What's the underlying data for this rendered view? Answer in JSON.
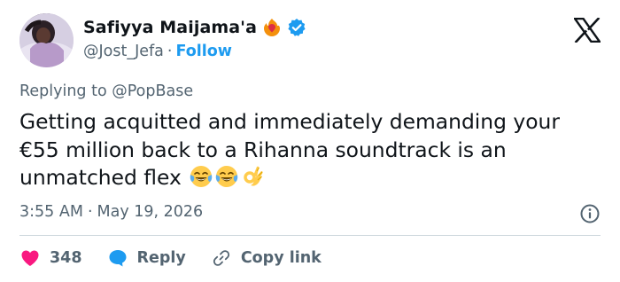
{
  "user": {
    "display_name": "Safiyya Maijama'a",
    "handle": "@Jost_Jefa",
    "separator": "·",
    "follow_label": "Follow"
  },
  "reply_context": {
    "prefix": "Replying to",
    "mention": "@PopBase"
  },
  "tweet": {
    "text": "Getting acquitted and immediately demanding your €55 million back to a Rihanna soundtrack is an unmatched flex",
    "emojis": [
      "tears-of-joy",
      "tears-of-joy",
      "ok-hand"
    ]
  },
  "meta": {
    "time": "3:55 AM",
    "separator": "·",
    "date": "May 19, 2026"
  },
  "actions": {
    "likes_count": "348",
    "reply_label": "Reply",
    "copy_link_label": "Copy link"
  },
  "colors": {
    "accent": "#1d9bf0",
    "like": "#f91880",
    "muted": "#536471",
    "text": "#0f1419",
    "divider": "#cfd9de"
  },
  "icons": [
    "x-logo-icon",
    "verified-badge-icon",
    "heart-on-fire-icon",
    "info-icon",
    "heart-icon",
    "reply-bubble-icon",
    "link-icon"
  ]
}
